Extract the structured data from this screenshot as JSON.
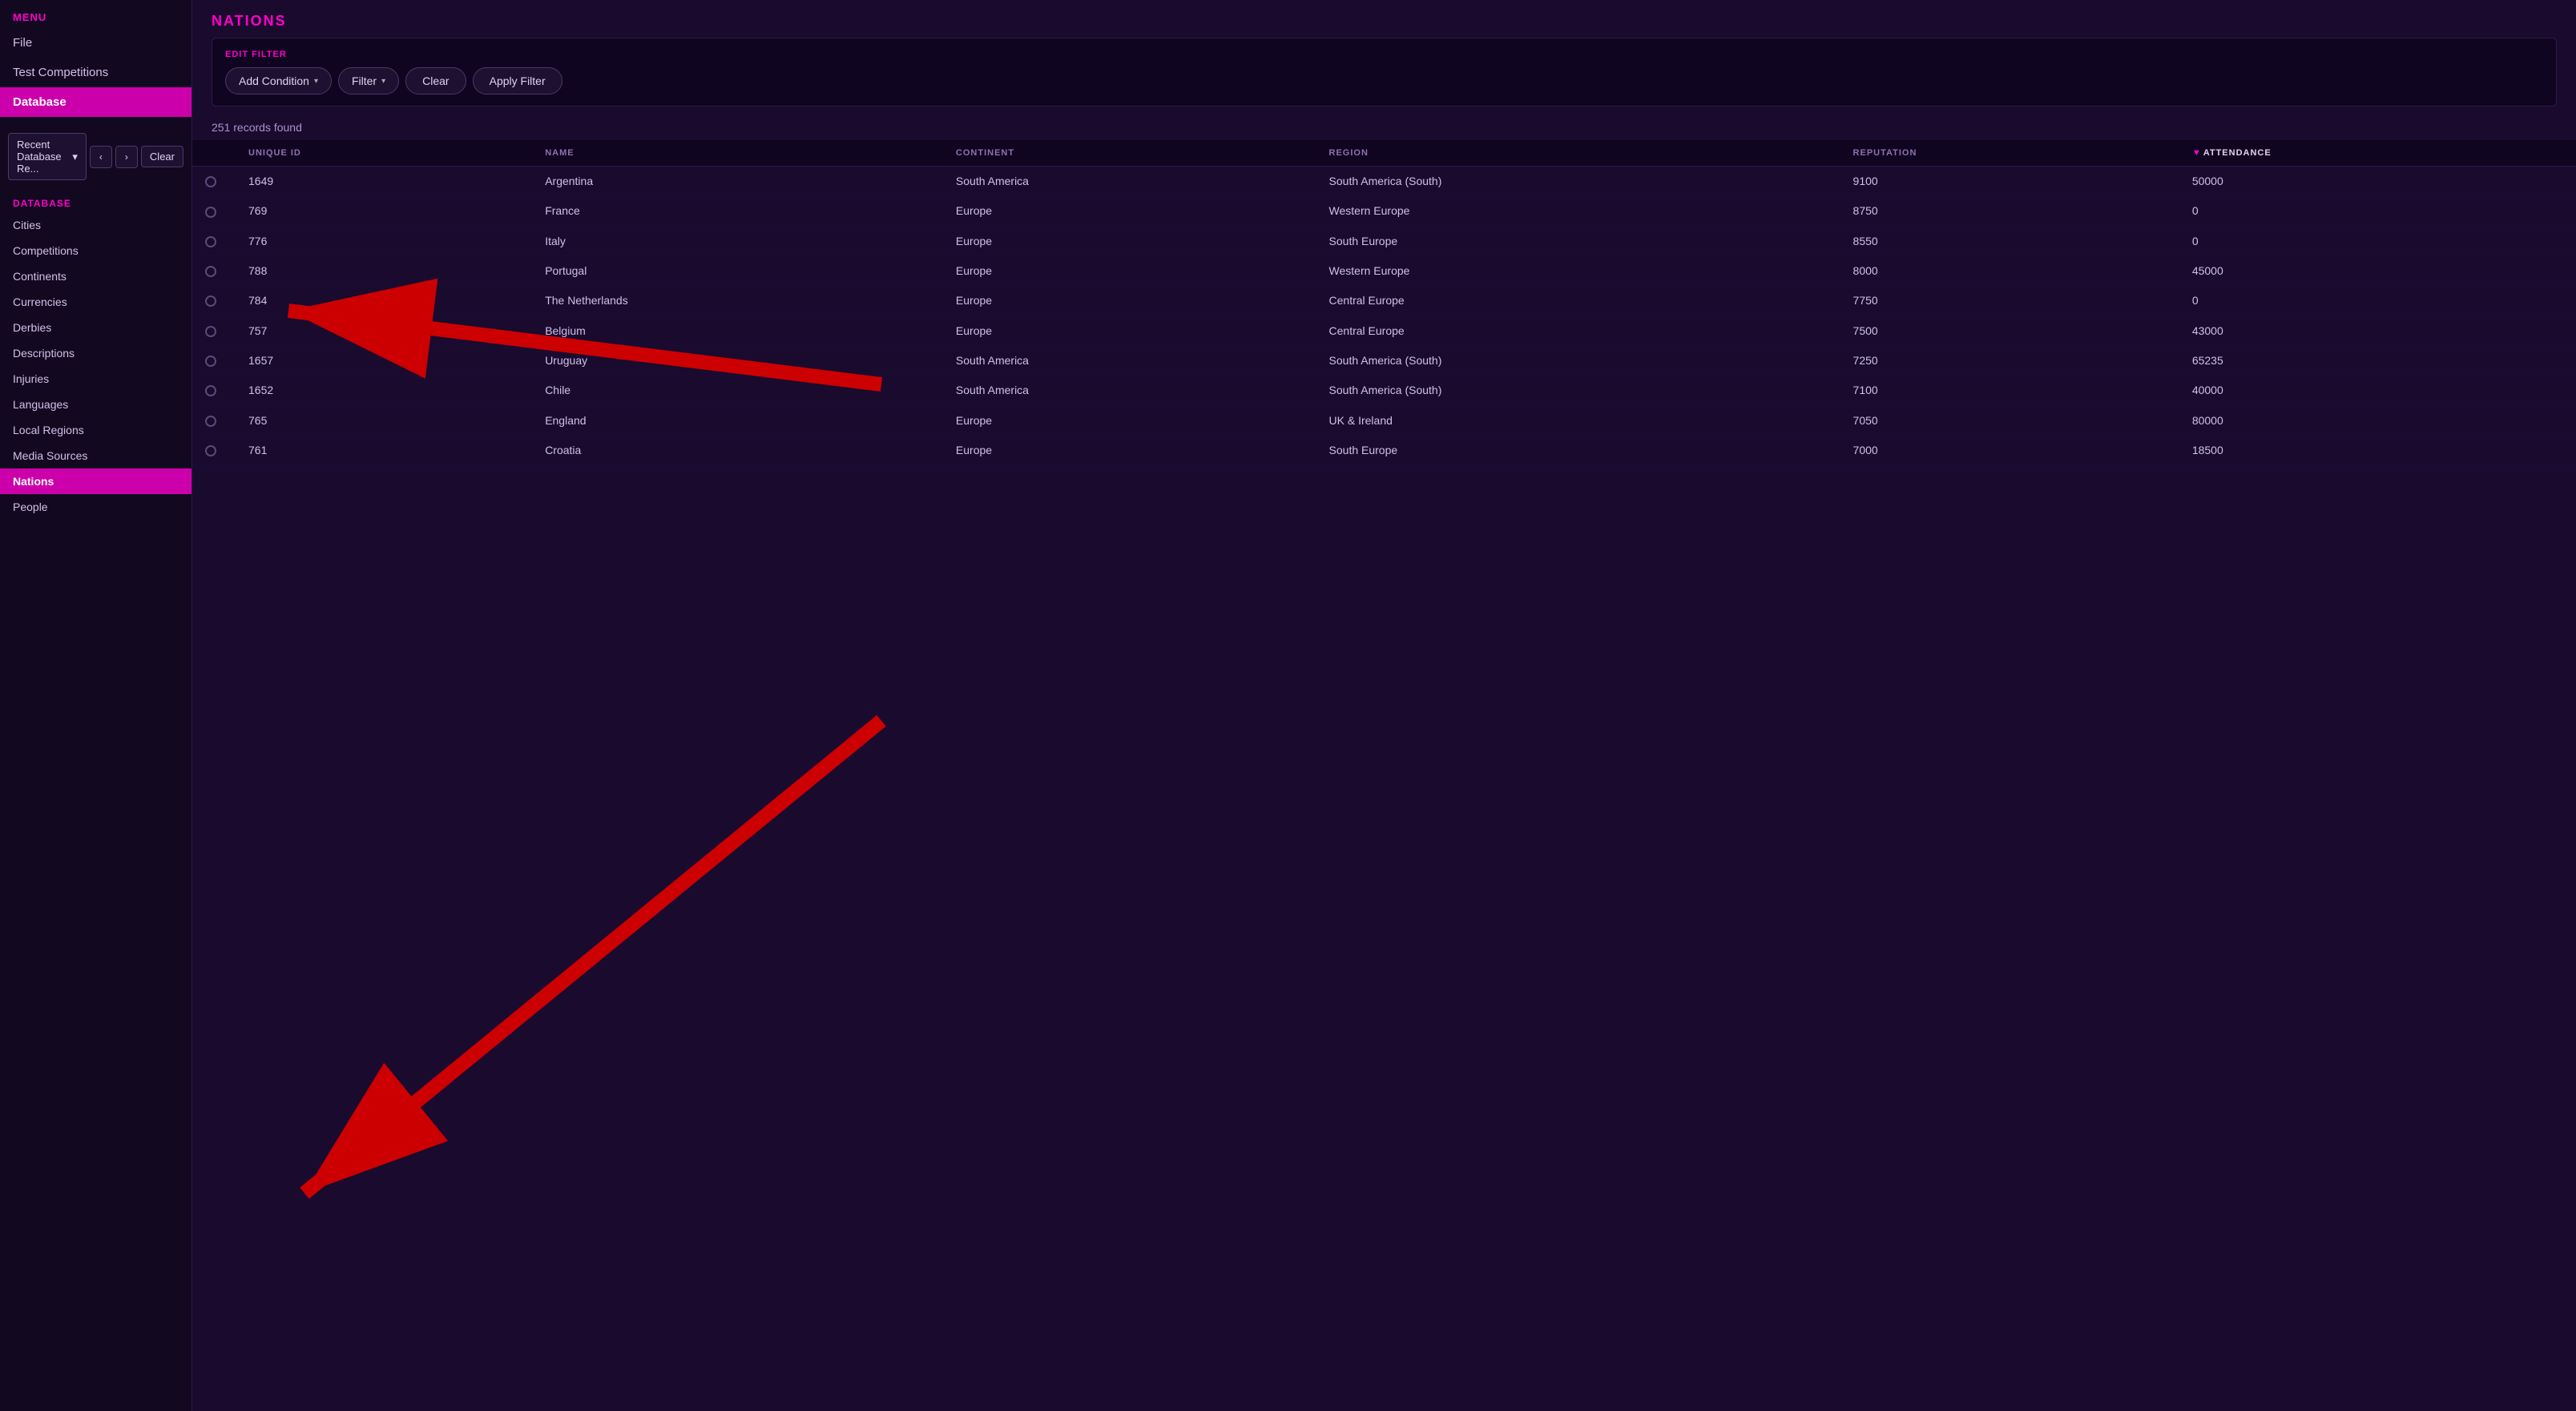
{
  "menu": {
    "label": "MENU",
    "items": [
      {
        "id": "file",
        "label": "File",
        "active": false
      },
      {
        "id": "test-competitions",
        "label": "Test Competitions",
        "active": false
      },
      {
        "id": "database",
        "label": "Database",
        "active": true
      }
    ]
  },
  "recent": {
    "label": "Recent Database Re...",
    "clear_label": "Clear"
  },
  "database": {
    "label": "DATABASE",
    "items": [
      {
        "id": "cities",
        "label": "Cities",
        "active": false
      },
      {
        "id": "competitions",
        "label": "Competitions",
        "active": false
      },
      {
        "id": "continents",
        "label": "Continents",
        "active": false
      },
      {
        "id": "currencies",
        "label": "Currencies",
        "active": false
      },
      {
        "id": "derbies",
        "label": "Derbies",
        "active": false
      },
      {
        "id": "descriptions",
        "label": "Descriptions",
        "active": false
      },
      {
        "id": "injuries",
        "label": "Injuries",
        "active": false
      },
      {
        "id": "languages",
        "label": "Languages",
        "active": false
      },
      {
        "id": "local-regions",
        "label": "Local Regions",
        "active": false
      },
      {
        "id": "media-sources",
        "label": "Media Sources",
        "active": false
      },
      {
        "id": "nations",
        "label": "Nations",
        "active": true
      },
      {
        "id": "people",
        "label": "People",
        "active": false
      }
    ]
  },
  "nations": {
    "title": "NATIONS",
    "edit_filter_label": "EDIT FILTER",
    "records_found": "251 records found",
    "filter_buttons": {
      "add_condition": "Add Condition",
      "filter": "Filter",
      "clear": "Clear",
      "apply_filter": "Apply Filter"
    }
  },
  "table": {
    "columns": [
      {
        "id": "unique-id",
        "label": "UNIQUE ID",
        "sorted": false
      },
      {
        "id": "name",
        "label": "NAME",
        "sorted": false
      },
      {
        "id": "continent",
        "label": "CONTINENT",
        "sorted": false
      },
      {
        "id": "region",
        "label": "REGION",
        "sorted": false
      },
      {
        "id": "reputation",
        "label": "REPUTATION",
        "sorted": false
      },
      {
        "id": "attendance",
        "label": "ATTENDANCE",
        "sorted": true,
        "sort_dir": "desc"
      }
    ],
    "rows": [
      {
        "id": "1649",
        "name": "Argentina",
        "continent": "South America",
        "region": "South America (South)",
        "reputation": "9100",
        "attendance": "50000"
      },
      {
        "id": "769",
        "name": "France",
        "continent": "Europe",
        "region": "Western Europe",
        "reputation": "8750",
        "attendance": "0"
      },
      {
        "id": "776",
        "name": "Italy",
        "continent": "Europe",
        "region": "South Europe",
        "reputation": "8550",
        "attendance": "0"
      },
      {
        "id": "788",
        "name": "Portugal",
        "continent": "Europe",
        "region": "Western Europe",
        "reputation": "8000",
        "attendance": "45000"
      },
      {
        "id": "784",
        "name": "The Netherlands",
        "continent": "Europe",
        "region": "Central Europe",
        "reputation": "7750",
        "attendance": "0"
      },
      {
        "id": "757",
        "name": "Belgium",
        "continent": "Europe",
        "region": "Central Europe",
        "reputation": "7500",
        "attendance": "43000"
      },
      {
        "id": "1657",
        "name": "Uruguay",
        "continent": "South America",
        "region": "South America (South)",
        "reputation": "7250",
        "attendance": "65235"
      },
      {
        "id": "1652",
        "name": "Chile",
        "continent": "South America",
        "region": "South America (South)",
        "reputation": "7100",
        "attendance": "40000"
      },
      {
        "id": "765",
        "name": "England",
        "continent": "Europe",
        "region": "UK & Ireland",
        "reputation": "7050",
        "attendance": "80000"
      },
      {
        "id": "761",
        "name": "Croatia",
        "continent": "Europe",
        "region": "South Europe",
        "reputation": "7000",
        "attendance": "18500"
      }
    ]
  }
}
